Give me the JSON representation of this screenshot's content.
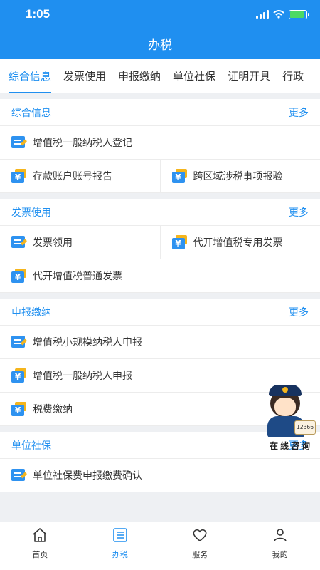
{
  "status_bar": {
    "time": "1:05"
  },
  "header": {
    "title": "办税"
  },
  "tabs": [
    {
      "label": "综合信息",
      "active": true
    },
    {
      "label": "发票使用",
      "active": false
    },
    {
      "label": "申报缴纳",
      "active": false
    },
    {
      "label": "单位社保",
      "active": false
    },
    {
      "label": "证明开具",
      "active": false
    },
    {
      "label": "行政",
      "active": false
    }
  ],
  "more_label": "更多",
  "sections": [
    {
      "title": "综合信息",
      "rows": [
        [
          {
            "label": "增值税一般纳税人登记",
            "icon": "edit-icon"
          }
        ],
        [
          {
            "label": "存款账户账号报告",
            "icon": "yen-icon"
          },
          {
            "label": "跨区域涉税事项报验",
            "icon": "yen-icon"
          }
        ]
      ]
    },
    {
      "title": "发票使用",
      "rows": [
        [
          {
            "label": "发票领用",
            "icon": "edit-icon"
          },
          {
            "label": "代开增值税专用发票",
            "icon": "yen-icon"
          }
        ],
        [
          {
            "label": "代开增值税普通发票",
            "icon": "yen-icon"
          }
        ]
      ]
    },
    {
      "title": "申报缴纳",
      "rows": [
        [
          {
            "label": "增值税小规模纳税人申报",
            "icon": "edit-icon"
          }
        ],
        [
          {
            "label": "增值税一般纳税人申报",
            "icon": "yen-icon"
          }
        ],
        [
          {
            "label": "税费缴纳",
            "icon": "yen-icon"
          }
        ]
      ]
    },
    {
      "title": "单位社保",
      "rows": [
        [
          {
            "label": "单位社保费申报缴费确认",
            "icon": "edit-icon"
          }
        ]
      ]
    }
  ],
  "mascot": {
    "caption": "在线咨询",
    "phone_text": "12366"
  },
  "bottom_nav": [
    {
      "label": "首页",
      "icon": "home-icon",
      "active": false
    },
    {
      "label": "办税",
      "icon": "list-icon",
      "active": true
    },
    {
      "label": "服务",
      "icon": "heart-icon",
      "active": false
    },
    {
      "label": "我的",
      "icon": "user-icon",
      "active": false
    }
  ],
  "colors": {
    "primary": "#1f8ff0",
    "icon_blue": "#2e92f0",
    "icon_yellow": "#f5b51c",
    "battery_green": "#4cd964"
  }
}
